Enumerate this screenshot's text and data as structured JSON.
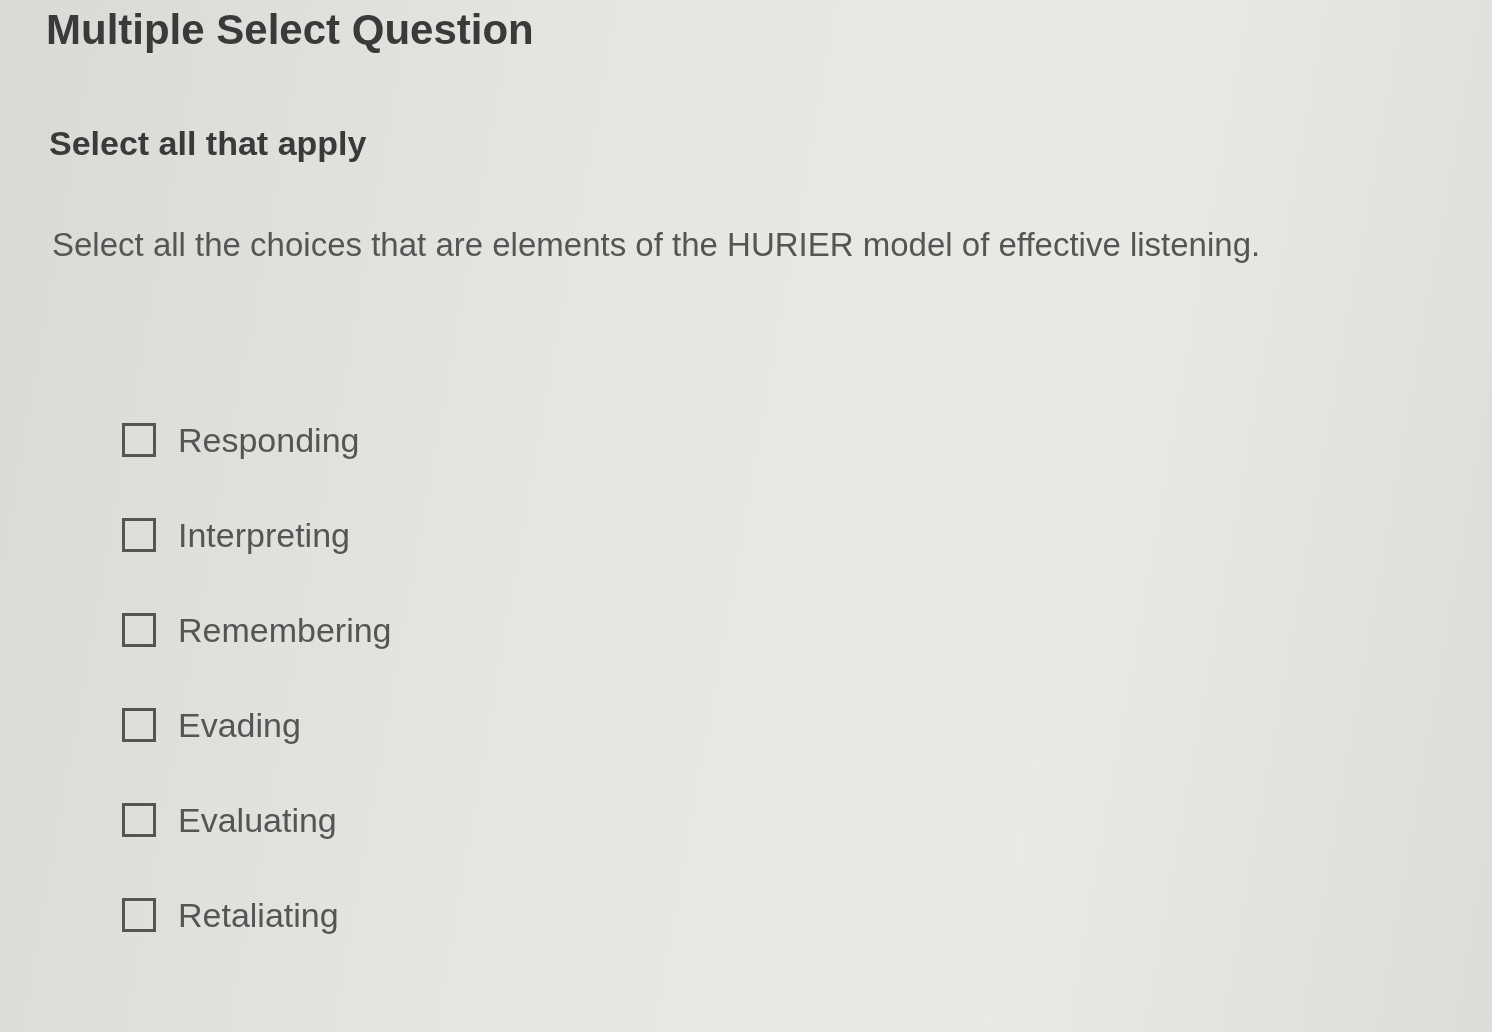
{
  "title": "Multiple Select Question",
  "instruction": "Select all that apply",
  "question": "Select all the choices that are elements of the HURIER model of effective listening.",
  "options": [
    {
      "label": "Responding",
      "checked": false
    },
    {
      "label": "Interpreting",
      "checked": false
    },
    {
      "label": "Remembering",
      "checked": false
    },
    {
      "label": "Evading",
      "checked": false
    },
    {
      "label": "Evaluating",
      "checked": false
    },
    {
      "label": "Retaliating",
      "checked": false
    }
  ]
}
